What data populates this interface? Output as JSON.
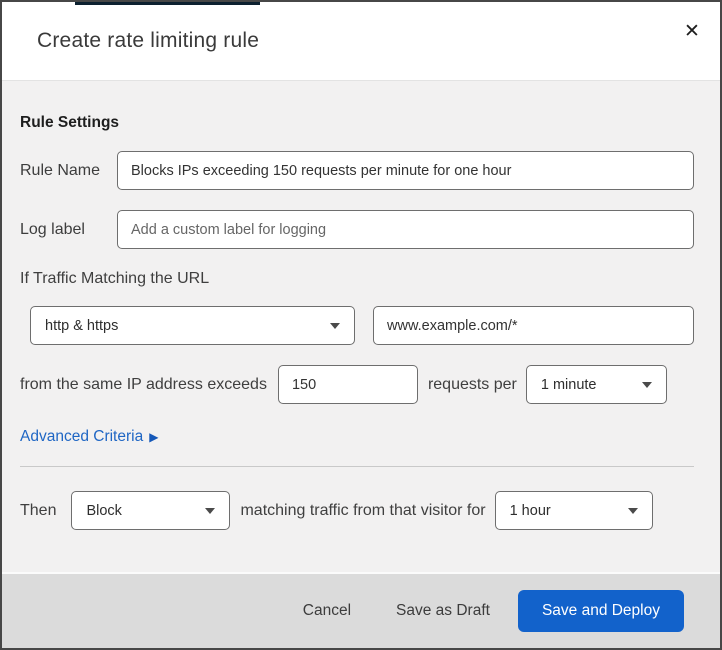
{
  "dialog": {
    "title": "Create rate limiting rule"
  },
  "icons": {
    "close": "✕",
    "advanced_arrow": "▶"
  },
  "rule_settings": {
    "heading": "Rule Settings",
    "rule_name": {
      "label": "Rule Name",
      "value": "Blocks IPs exceeding 150 requests per minute for one hour"
    },
    "log_label": {
      "label": "Log label",
      "placeholder": "Add a custom label for logging"
    }
  },
  "criteria": {
    "intro": "If Traffic Matching the URL",
    "scheme_select": {
      "value": "http & https"
    },
    "url_input": {
      "value": "www.example.com/*"
    },
    "exceeds_prefix": "from the same IP address exceeds",
    "requests_value": "150",
    "requests_per_label": "requests per",
    "period_select": {
      "value": "1 minute"
    },
    "advanced_link_label": "Advanced Criteria"
  },
  "action": {
    "then_label": "Then",
    "action_select": {
      "value": "Block"
    },
    "middle_text": "matching traffic from that visitor for",
    "duration_select": {
      "value": "1 hour"
    }
  },
  "footer": {
    "cancel_label": "Cancel",
    "save_draft_label": "Save as Draft",
    "save_deploy_label": "Save and Deploy"
  },
  "colors": {
    "primary_blue": "#1262cb",
    "link_blue": "#1f66c4",
    "body_background": "#f2f1f1",
    "footer_background": "#dbdbdb",
    "input_border": "#6e6e6e",
    "dialog_border": "#474747"
  }
}
